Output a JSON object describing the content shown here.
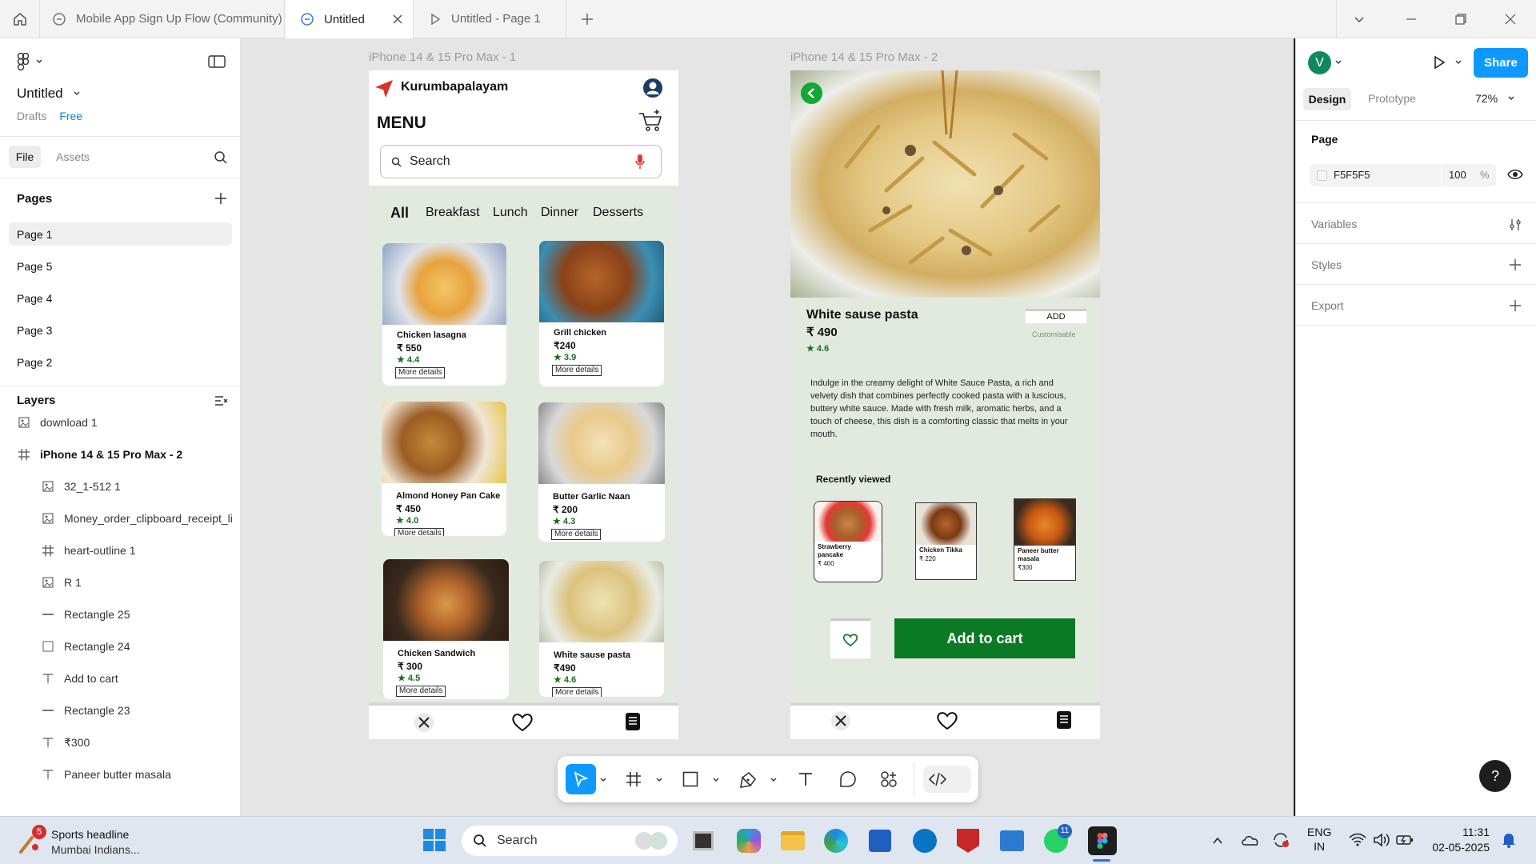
{
  "tabs": [
    {
      "label": "Mobile App Sign Up Flow (Community)"
    },
    {
      "label": "Untitled"
    },
    {
      "label": "Untitled - Page 1"
    }
  ],
  "file": {
    "name": "Untitled",
    "location": "Drafts",
    "plan": "Free"
  },
  "panel_tabs": {
    "file": "File",
    "assets": "Assets"
  },
  "pages": {
    "title": "Pages",
    "items": [
      "Page 1",
      "Page 5",
      "Page 4",
      "Page 3",
      "Page 2"
    ]
  },
  "layers": {
    "title": "Layers",
    "items": [
      {
        "name": "download 1",
        "icon": "image-icon"
      },
      {
        "name": "iPhone 14 & 15 Pro Max - 2",
        "icon": "frame-icon"
      },
      {
        "name": "32_1-512 1",
        "icon": "image-icon"
      },
      {
        "name": "Money_order_clipboard_receipt_li",
        "icon": "image-icon"
      },
      {
        "name": "heart-outline 1",
        "icon": "frame-icon"
      },
      {
        "name": "R 1",
        "icon": "image-icon"
      },
      {
        "name": "Rectangle 25",
        "icon": "line-icon"
      },
      {
        "name": "Rectangle 24",
        "icon": "rectangle-icon"
      },
      {
        "name": "Add to cart",
        "icon": "text-icon"
      },
      {
        "name": "Rectangle 23",
        "icon": "line-icon"
      },
      {
        "name": "₹300",
        "icon": "text-icon"
      },
      {
        "name": "Paneer butter masala",
        "icon": "text-icon"
      }
    ]
  },
  "frame1": {
    "label": "iPhone 14 & 15 Pro Max - 1",
    "location": "Kurumbapalayam",
    "menu_title": "MENU",
    "search_placeholder": "Search",
    "categories": [
      "All",
      "Breakfast",
      "Lunch",
      "Dinner",
      "Desserts"
    ],
    "cards": [
      {
        "name": "Chicken lasagna",
        "price": "₹ 550",
        "rating": "★ 4.4",
        "more": "More details"
      },
      {
        "name": "Grill chicken",
        "price": "₹240",
        "rating": "★ 3.9",
        "more": "More details"
      },
      {
        "name": "Almond Honey Pan Cake",
        "price": "₹ 450",
        "rating": "★ 4.0",
        "more": "More details"
      },
      {
        "name": "Butter Garlic Naan",
        "price": "₹ 200",
        "rating": "★ 4.3",
        "more": "More details"
      },
      {
        "name": "Chicken Sandwich",
        "price": "₹ 300",
        "rating": "★ 4.5",
        "more": "More details"
      },
      {
        "name": "White sause pasta",
        "price": "₹490",
        "rating": "★ 4.6",
        "more": "More details"
      }
    ]
  },
  "frame2": {
    "label": "iPhone 14 & 15 Pro Max - 2",
    "title": "White sause pasta",
    "price": "₹ 490",
    "rating": "★ 4.6",
    "add": "ADD",
    "customisable": "Customisable",
    "description": "Indulge in the creamy delight of White Sauce Pasta, a rich and velvety dish that combines perfectly cooked pasta with a luscious, buttery white sauce. Made with fresh milk, aromatic herbs, and a touch of cheese, this dish is a comforting classic that melts in your mouth.",
    "recent_title": "Recently viewed",
    "recent": [
      {
        "name": "Strawberry pancake",
        "price": "₹ 400"
      },
      {
        "name": "Chicken Tikka",
        "price": "₹ 220"
      },
      {
        "name": "Paneer butter masala",
        "price": "₹300"
      }
    ],
    "add_to_cart": "Add to cart"
  },
  "right": {
    "avatar": "V",
    "share": "Share",
    "tab_design": "Design",
    "tab_prototype": "Prototype",
    "zoom": "72%",
    "page_title": "Page",
    "page_color": "F5F5F5",
    "page_opacity": "100",
    "percent": "%",
    "variables": "Variables",
    "styles": "Styles",
    "export": "Export",
    "help": "?"
  },
  "taskbar": {
    "news_title": "Sports headline",
    "news_sub": "Mumbai Indians...",
    "news_badge": "5",
    "search": "Search",
    "whatsapp_badge": "11",
    "lang1": "ENG",
    "lang2": "IN",
    "time": "11:31",
    "date": "02-05-2025"
  },
  "colors": {
    "accent": "#0d99ff",
    "frame_bg": "#e2eadf",
    "green": "#0b7a24"
  }
}
